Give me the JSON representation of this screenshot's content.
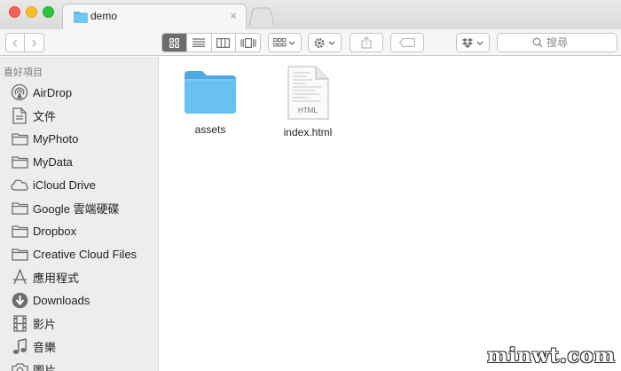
{
  "window": {
    "tab_title": "demo",
    "tab_close": "×"
  },
  "toolbar": {
    "back": "‹",
    "forward": "›",
    "search_placeholder": "搜尋",
    "view_modes": [
      "icon-view",
      "list-view",
      "column-view",
      "cover-flow-view"
    ],
    "active_view": "icon-view"
  },
  "sidebar": {
    "header": "喜好項目",
    "items": [
      {
        "label": "AirDrop",
        "icon": "airdrop-icon"
      },
      {
        "label": "文件",
        "icon": "document-icon"
      },
      {
        "label": "MyPhoto",
        "icon": "folder-icon"
      },
      {
        "label": "MyData",
        "icon": "folder-icon"
      },
      {
        "label": "iCloud Drive",
        "icon": "cloud-icon"
      },
      {
        "label": "Google 雲端硬碟",
        "icon": "folder-icon"
      },
      {
        "label": "Dropbox",
        "icon": "folder-icon"
      },
      {
        "label": "Creative Cloud Files",
        "icon": "folder-icon"
      },
      {
        "label": "應用程式",
        "icon": "applications-icon"
      },
      {
        "label": "Downloads",
        "icon": "download-icon"
      },
      {
        "label": "影片",
        "icon": "film-icon"
      },
      {
        "label": "音樂",
        "icon": "music-icon"
      },
      {
        "label": "圖片",
        "icon": "camera-icon"
      }
    ]
  },
  "files": [
    {
      "name": "assets",
      "type": "folder"
    },
    {
      "name": "index.html",
      "type": "html",
      "badge": "HTML"
    }
  ],
  "watermark": "minwt.com",
  "colors": {
    "folder_blue": "#5ab8ef",
    "sidebar_bg": "#eeeded",
    "active_segment": "#6c6c6c"
  }
}
